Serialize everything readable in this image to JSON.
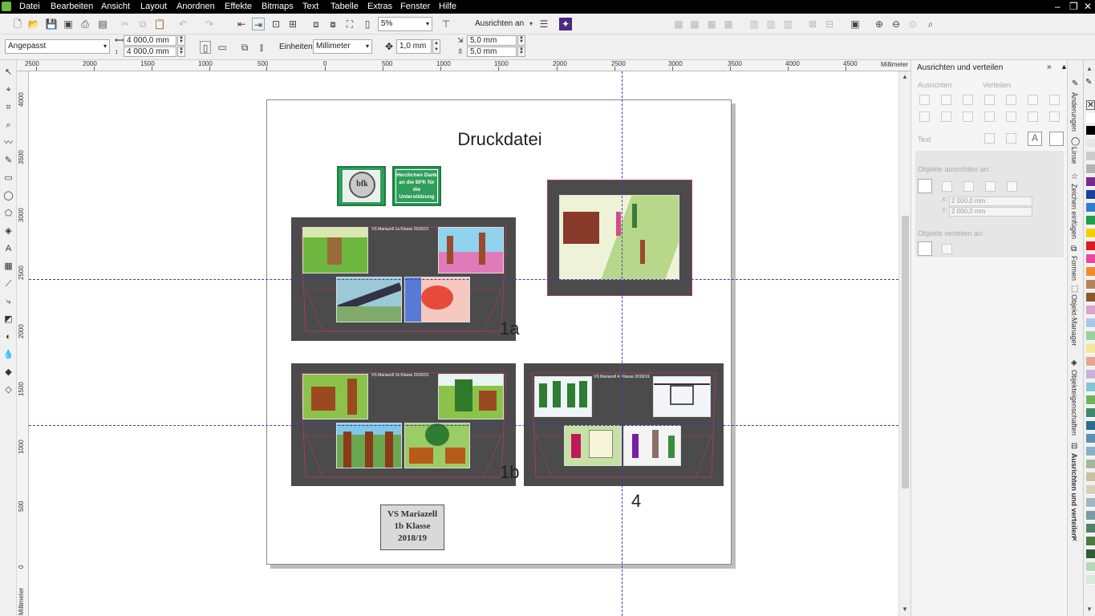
{
  "menu": {
    "items": [
      "Datei",
      "Bearbeiten",
      "Ansicht",
      "Layout",
      "Anordnen",
      "Effekte",
      "Bitmaps",
      "Text",
      "Tabelle",
      "Extras",
      "Fenster",
      "Hilfe"
    ]
  },
  "toolbar": {
    "zoom_value": "5%",
    "snap_label": "Ausrichten an"
  },
  "property_bar": {
    "page_preset": "Angepasst",
    "width": "4 000,0 mm",
    "height": "4 000,0 mm",
    "units_label": "Einheiten:",
    "units_value": "Millimeter",
    "nudge": "1,0 mm",
    "dup_x": "5,0 mm",
    "dup_y": "5,0 mm"
  },
  "ruler": {
    "unit_label": "Millimeter",
    "top_ticks": [
      "2500",
      "2000",
      "1500",
      "1000",
      "500",
      "0",
      "500",
      "1000",
      "1500",
      "2000",
      "2500",
      "3000",
      "3500",
      "4000",
      "4500",
      "5000"
    ],
    "left_ticks": [
      "4000",
      "3500",
      "3000",
      "2500",
      "2000",
      "1500",
      "1000",
      "500",
      "0",
      "Millimeter"
    ]
  },
  "canvas": {
    "page_title": "Druckdatei",
    "logo_text": "bfk",
    "thanks_text": "Herzlichen Dank an die BFK für die Unterstützung",
    "panel_1a_title": "VS Mariazell 1a Klasse 2018/19",
    "panel_1b_title": "VS Mariazell 1b Klasse 2018/19",
    "panel_4_title": "VS Mariazell 4. Klasse 2018/19",
    "label_1a": "1a",
    "label_1b": "1b",
    "label_4": "4",
    "info_box": {
      "line1": "VS Mariazell",
      "line2": "1b Klasse",
      "line3": "2018/19"
    }
  },
  "docker": {
    "title": "Ausrichten und verteilen",
    "align_label": "Ausrichten",
    "distribute_label": "Verteilen",
    "text_label": "Text",
    "align_to_label": "Objekte ausrichten an:",
    "x_value": "2 000,0 mm",
    "y_value": "2 000,0 mm",
    "distribute_to_label": "Objekte verteilen an:"
  },
  "docker_tabs": [
    "Änderungen",
    "Linse",
    "Zeichen einfügen",
    "Formen",
    "Objekt-Manager",
    "Objekteigenschaften",
    "Ausrichten und verteilen"
  ],
  "palette_colors": [
    "#ffffff",
    "#000000",
    "#e6e6e6",
    "#cccccc",
    "#b3b3b3",
    "#7a2a8c",
    "#1f3f9e",
    "#2f7fd1",
    "#1aa04a",
    "#f5d000",
    "#e11b22",
    "#e84a9b",
    "#f28b2c",
    "#b5835a",
    "#8b5a2b",
    "#d9a5c9",
    "#a8c8e8",
    "#9ad0a0",
    "#f4e79a",
    "#e9a28f",
    "#c9b2d9",
    "#7fc6d6",
    "#6fb45b",
    "#3f8a6a",
    "#2c6c8e",
    "#5e8fb5",
    "#8ab0c8",
    "#a5b6a0",
    "#c6c1a0",
    "#d7d0b8",
    "#9fb8bf",
    "#7a9aa5",
    "#55806a",
    "#4d7a3f",
    "#2e5e35",
    "#b5d8b5",
    "#d8ead8"
  ]
}
